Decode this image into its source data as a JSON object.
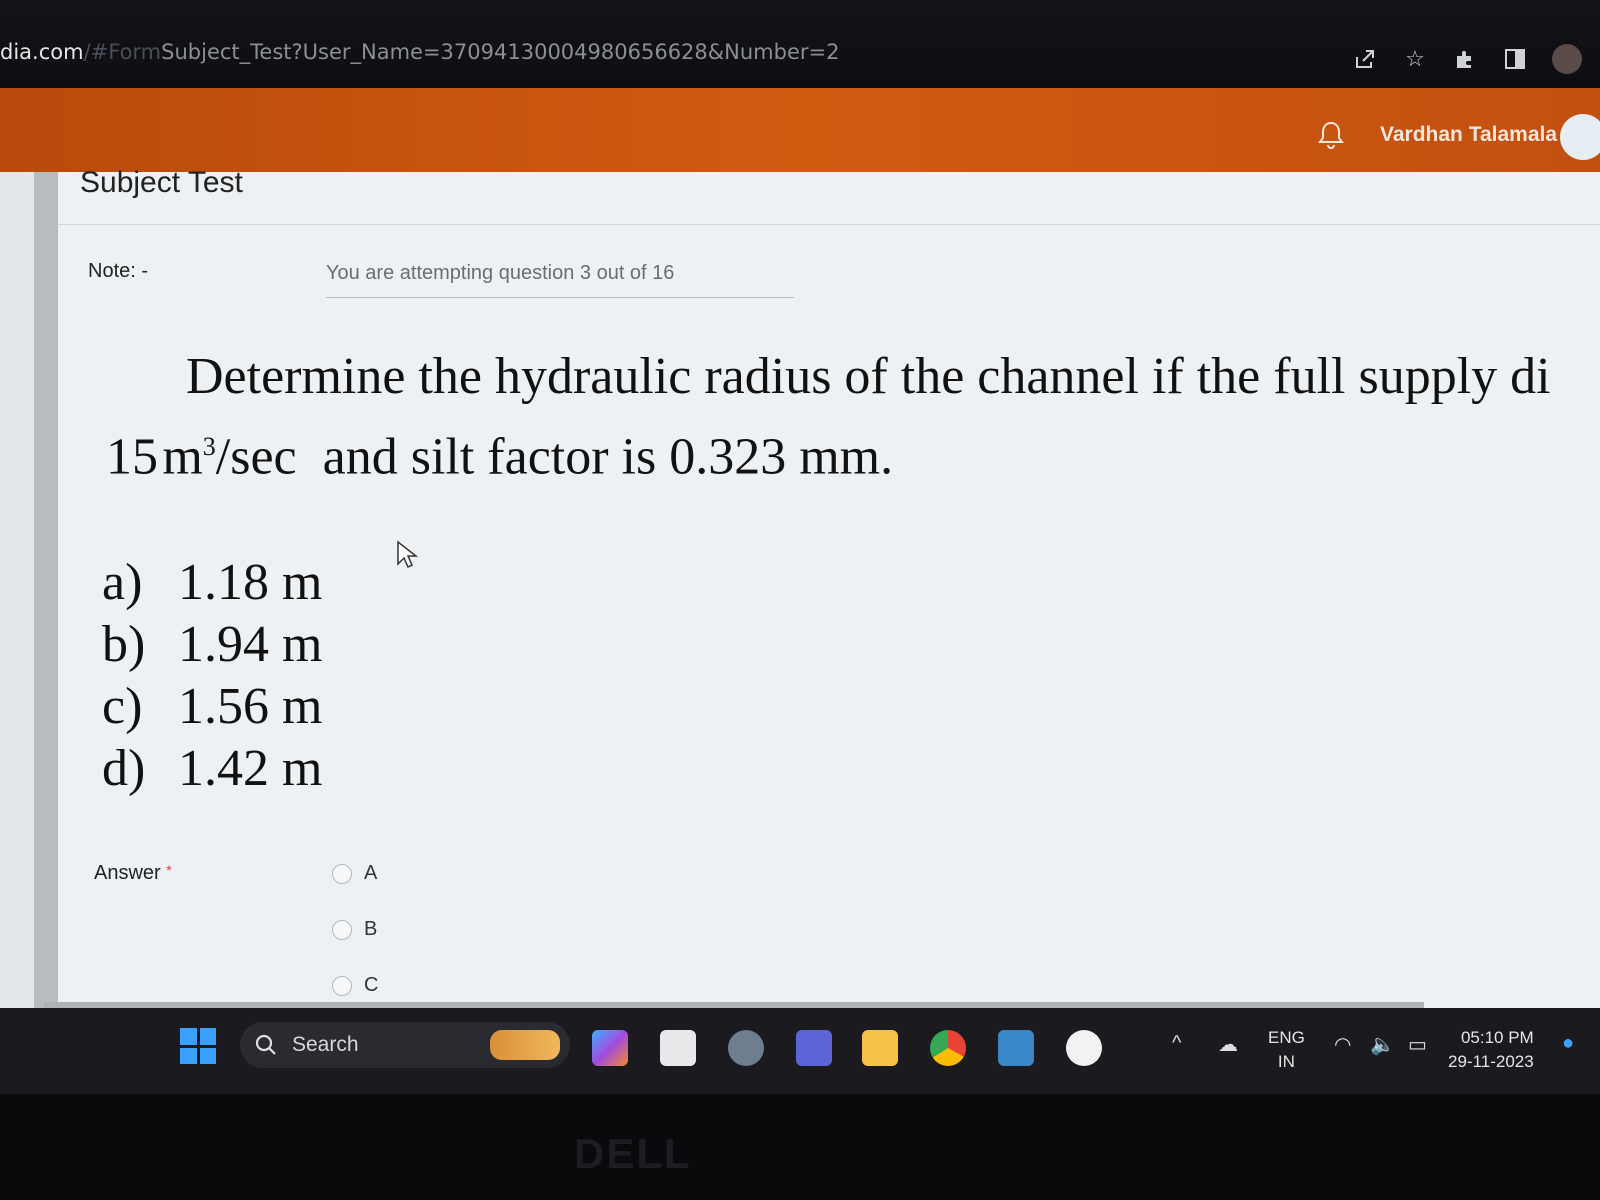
{
  "browser": {
    "url_domain": "dia.com",
    "url_hash": "/#Form",
    "url_path": "Subject_Test?User_Name=37094130004980656628&Number=2",
    "icons": [
      "share-icon",
      "star-icon",
      "extensions-icon",
      "sidepanel-icon",
      "profile-icon"
    ]
  },
  "appbar": {
    "username": "Vardhan Talamala",
    "icons": [
      "bell-icon",
      "avatar"
    ]
  },
  "page": {
    "title": "Subject Test",
    "note_label": "Note: -",
    "note_text": "You are attempting question 3 out of 16"
  },
  "question": {
    "line1": "Determine the hydraulic radius of the channel if the full supply di",
    "line2_number": "15",
    "line2_unit": "m",
    "line2_exp": "3",
    "line2_per": "/sec",
    "line2_rest": "and silt factor is 0.323 mm.",
    "options": [
      {
        "letter": "a)",
        "text": "1.18 m"
      },
      {
        "letter": "b)",
        "text": "1.94 m"
      },
      {
        "letter": "c)",
        "text": "1.56 m"
      },
      {
        "letter": "d)",
        "text": "1.42 m"
      }
    ]
  },
  "answer": {
    "label": "Answer",
    "required_mark": "*",
    "choices": [
      "A",
      "B",
      "C"
    ]
  },
  "taskbar": {
    "search_label": "Search",
    "lang_top": "ENG",
    "lang_bottom": "IN",
    "time": "05:10 PM",
    "date": "29-11-2023",
    "app_icons": [
      "windows-start-icon",
      "copilot-icon",
      "task-view-icon",
      "settings-icon",
      "teams-icon",
      "file-explorer-icon",
      "chrome-icon",
      "calculator-icon",
      "nxtwave-icon"
    ]
  },
  "hardware": {
    "brand": "DELL"
  }
}
